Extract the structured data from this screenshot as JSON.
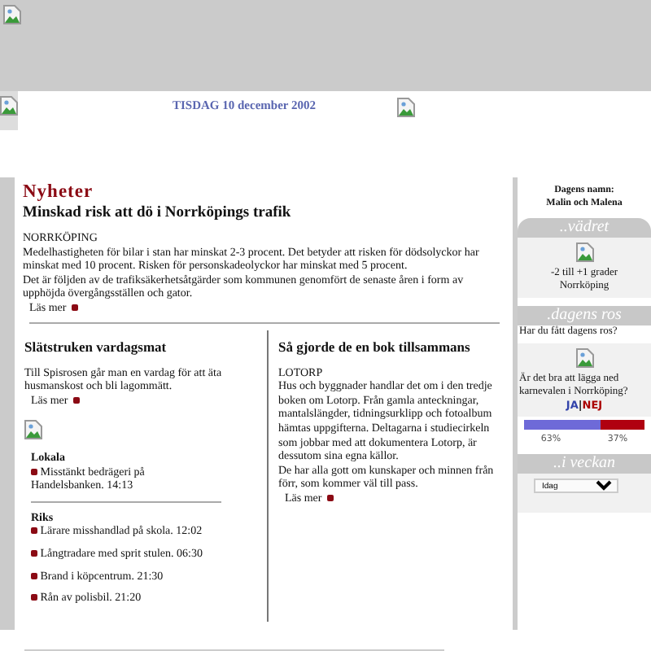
{
  "date": "TISDAG 10 december 2002",
  "main": {
    "section": "Nyheter",
    "headline": "Minskad risk att dö i Norrköpings trafik",
    "place": "NORRKÖPING",
    "body": [
      "Medelhastigheten för bilar i stan har minskat 2-3 procent. Det betyder att risken för dödsolyckor har minskat med 10 procent. Risken för personskadeolyckor har minskat med 5 procent.",
      "Det är följden av de trafiksäkerhetsåtgärder som kommunen genomfört de senaste åren i form av upphöjda övergångsställen och gator."
    ],
    "more": "Läs mer"
  },
  "left": {
    "headline": "Slätstruken vardagsmat",
    "body": "Till Spisrosen går man en vardag för att äta husmanskost och bli lagommätt.",
    "more": "Läs mer",
    "groups": [
      {
        "title": "Lokala",
        "items": [
          "Misstänkt bedrägeri på Handelsbanken. 14:13"
        ]
      },
      {
        "title": "Riks",
        "items": [
          "Lärare misshandlad på skola. 12:02",
          "Långtradare med sprit stulen. 06:30",
          "Brand i köpcentrum. 21:30",
          "Rån av polisbil. 21:20"
        ]
      }
    ]
  },
  "right": {
    "headline": "Så gjorde de en bok tillsammans",
    "place": "LOTORP",
    "body": [
      "Hus och byggnader handlar det om i den tredje boken om Lotorp. Från gamla anteckningar, mantalslängder, tidningsurklipp och fotoalbum hämtas uppgifterna. Deltagarna i studiecirkeln som jobbar med att dokumentera Lotorp, är dessutom sina egna källor.",
      "De har alla gott om kunskaper och minnen från förr, som kommer väl till pass."
    ],
    "more": "Läs mer"
  },
  "sidebar": {
    "name_label": "Dagens namn:",
    "names": "Malin och Malena",
    "weather_title": "..vädret",
    "weather": [
      "-2 till +1 grader",
      "Norrköping"
    ],
    "ros_title": ".dagens ros",
    "ros_text": "Har du fått dagens ros?",
    "poll_question": "Är det bra att lägga ned karnevalen i Norrköping?",
    "poll_yes": "JA",
    "poll_sep": "|",
    "poll_no": "NEJ",
    "poll": {
      "level": 0.63
    },
    "yes_pct": "63%",
    "no_pct": "37%",
    "week_title": "..i veckan",
    "week_select": "Idag"
  }
}
